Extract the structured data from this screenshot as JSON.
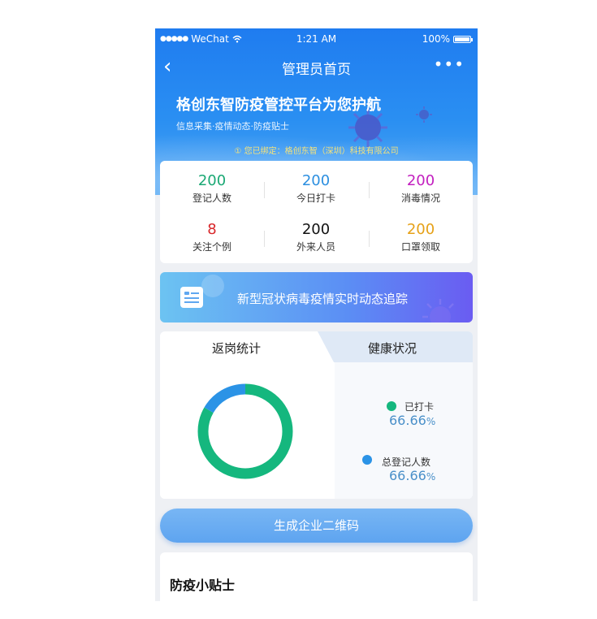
{
  "status_bar": {
    "carrier": "WeChat",
    "time": "1:21 AM",
    "battery": "100%"
  },
  "nav": {
    "title": "管理员首页",
    "more": "•••"
  },
  "hero": {
    "title": "格创东智防疫管控平台为您护航",
    "subtitle": "信息采集·疫情动态·防疫贴士",
    "binding": "① 您已绑定：格创东智（深圳）科技有限公司"
  },
  "stats": [
    {
      "value": "200",
      "label": "登记人数",
      "color": "#1aa874"
    },
    {
      "value": "200",
      "label": "今日打卡",
      "color": "#2c8fe0"
    },
    {
      "value": "200",
      "label": "消毒情况",
      "color": "#c21fbf"
    },
    {
      "value": "8",
      "label": "关注个例",
      "color": "#d8262a"
    },
    {
      "value": "200",
      "label": "外来人员",
      "color": "#111111"
    },
    {
      "value": "200",
      "label": "口罩领取",
      "color": "#e6a117"
    }
  ],
  "banner": {
    "text": "新型冠状病毒疫情实时动态追踪"
  },
  "tabs": [
    {
      "label": "返岗统计",
      "active": true
    },
    {
      "label": "健康状况",
      "active": false
    }
  ],
  "donut": {
    "segments": [
      {
        "name": "已打卡",
        "fraction": 0.8333,
        "color": "#15b77e"
      },
      {
        "name": "总登记人数",
        "fraction": 0.1667,
        "color": "#2b93e6"
      }
    ]
  },
  "legend": [
    {
      "label": "已打卡",
      "value": "66.66",
      "unit": "%",
      "color": "#15b77e"
    },
    {
      "label": "总登记人数",
      "value": "66.66",
      "unit": "%",
      "color": "#2b93e6"
    }
  ],
  "qr_button": {
    "label": "生成企业二维码"
  },
  "tips": {
    "title": "防疫小贴士"
  }
}
